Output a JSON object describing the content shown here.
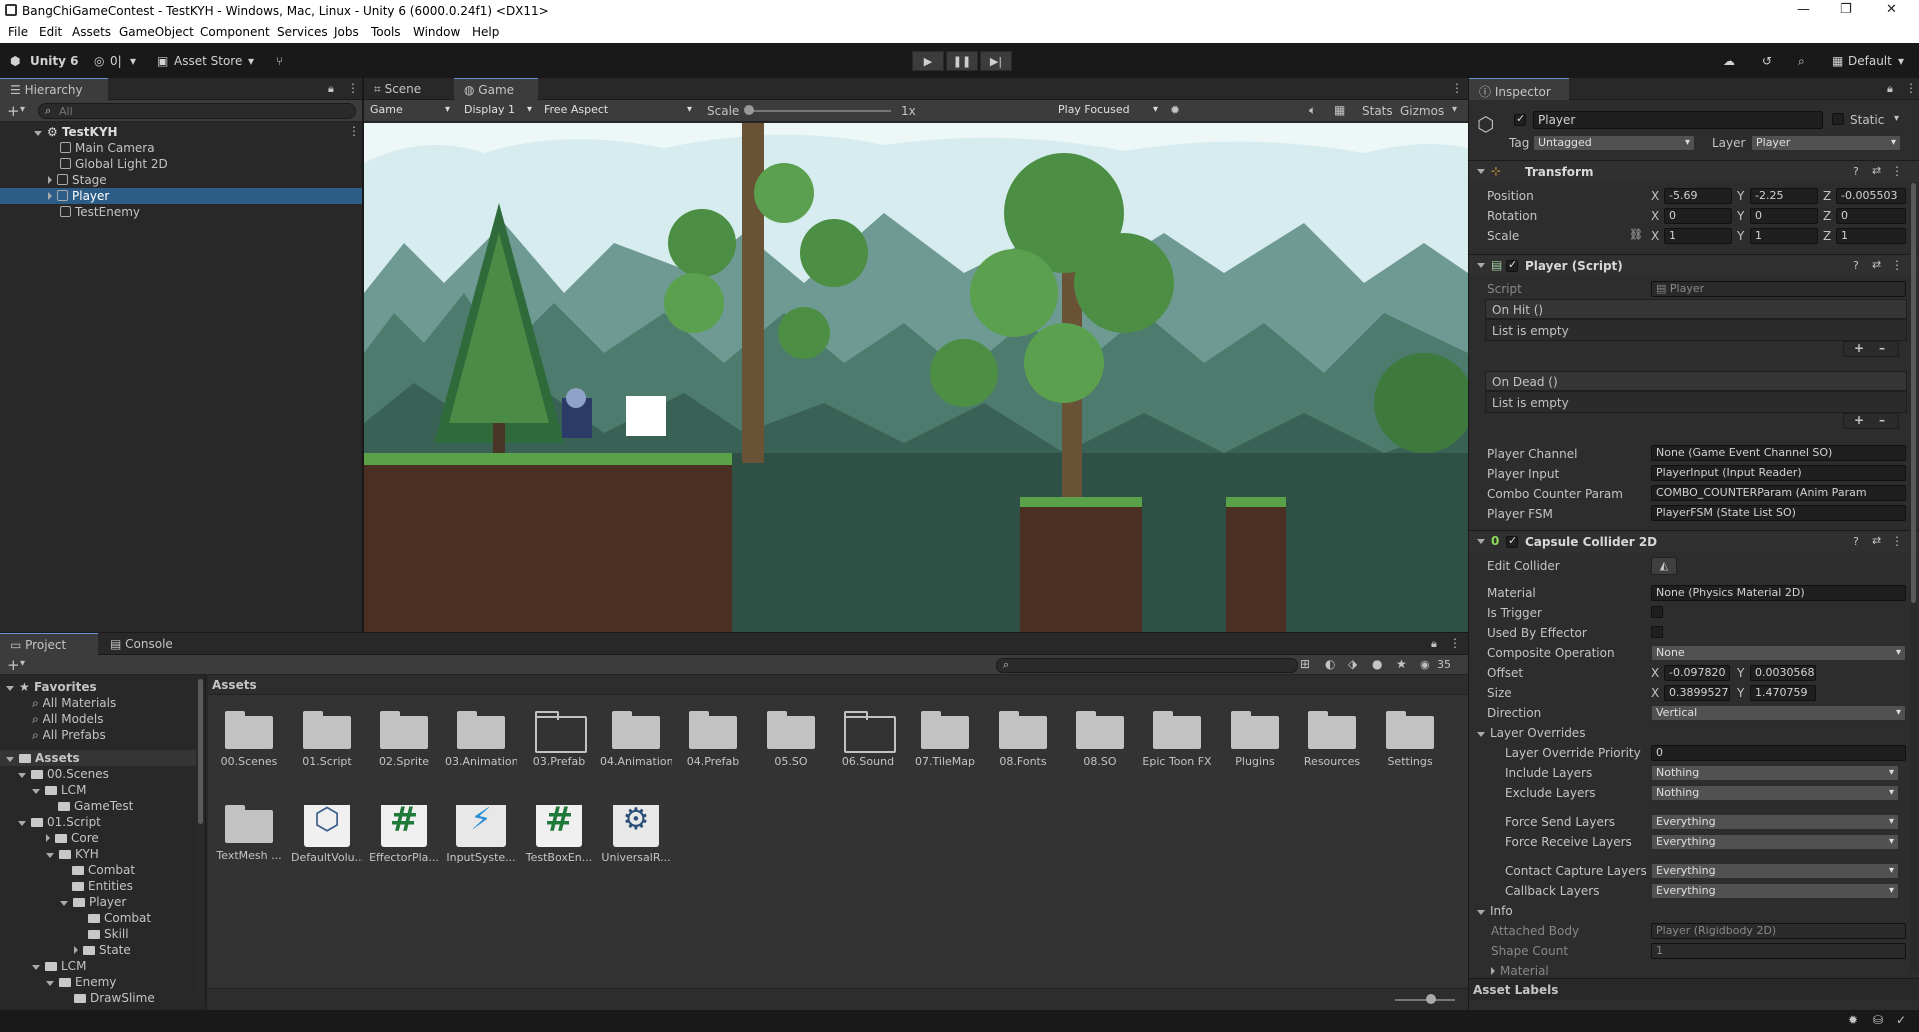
{
  "window": {
    "title": "BangChiGameContest - TestKYH - Windows, Mac, Linux - Unity 6 (6000.0.24f1) <DX11>"
  },
  "menu": [
    "File",
    "Edit",
    "Assets",
    "GameObject",
    "Component",
    "Services",
    "Jobs",
    "Tools",
    "Window",
    "Help"
  ],
  "toolbar": {
    "account": "Unity 6",
    "collab": "0|",
    "asset_store": "Asset Store",
    "layout": "Default"
  },
  "hierarchy": {
    "tab": "Hierarchy",
    "search_placeholder": "All",
    "scene": "TestKYH",
    "items": [
      "Main Camera",
      "Global Light 2D",
      "Stage",
      "Player",
      "TestEnemy"
    ]
  },
  "game_view": {
    "tabs": [
      "Scene",
      "Game"
    ],
    "mode": "Game",
    "display": "Display 1",
    "aspect": "Free Aspect",
    "scale_label": "Scale",
    "scale_value": "1x",
    "play_mode": "Play Focused",
    "stats": "Stats",
    "gizmos": "Gizmos"
  },
  "inspector": {
    "tab": "Inspector",
    "object_name": "Player",
    "static_label": "Static",
    "tag_label": "Tag",
    "tag_value": "Untagged",
    "layer_label": "Layer",
    "layer_value": "Player",
    "transform": {
      "title": "Transform",
      "position_label": "Position",
      "pos_x": "-5.69",
      "pos_y": "-2.25",
      "pos_z": "-0.005503",
      "rotation_label": "Rotation",
      "rot_x": "0",
      "rot_y": "0",
      "rot_z": "0",
      "scale_label": "Scale",
      "scale_x": "1",
      "scale_y": "1",
      "scale_z": "1"
    },
    "player_script": {
      "title": "Player (Script)",
      "script_label": "Script",
      "script_value": "Player",
      "on_hit": "On Hit ()",
      "on_hit_list": "List is empty",
      "on_dead": "On Dead ()",
      "on_dead_list": "List is empty",
      "player_channel_label": "Player Channel",
      "player_channel_value": "None (Game Event Channel SO)",
      "player_input_label": "Player Input",
      "player_input_value": "PlayerInput (Input Reader)",
      "combo_label": "Combo Counter Param",
      "combo_value": "COMBO_COUNTERParam (Anim Param",
      "fsm_label": "Player FSM",
      "fsm_value": "PlayerFSM (State List SO)"
    },
    "collider": {
      "title": "Capsule Collider 2D",
      "edit_label": "Edit Collider",
      "material_label": "Material",
      "material_value": "None (Physics Material 2D)",
      "trigger_label": "Is Trigger",
      "effector_label": "Used By Effector",
      "composite_label": "Composite Operation",
      "composite_value": "None",
      "offset_label": "Offset",
      "offset_x": "-0.097820",
      "offset_y": "0.0030568",
      "size_label": "Size",
      "size_x": "0.3899527",
      "size_y": "1.470759",
      "direction_label": "Direction",
      "direction_value": "Vertical",
      "layer_overrides": "Layer Overrides",
      "priority_label": "Layer Override Priority",
      "priority_value": "0",
      "include_label": "Include Layers",
      "include_value": "Nothing",
      "exclude_label": "Exclude Layers",
      "exclude_value": "Nothing",
      "force_send_label": "Force Send Layers",
      "force_send_value": "Everything",
      "force_receive_label": "Force Receive Layers",
      "force_receive_value": "Everything",
      "contact_label": "Contact Capture Layers",
      "contact_value": "Everything",
      "callback_label": "Callback Layers",
      "callback_value": "Everything",
      "info": "Info",
      "attached_label": "Attached Body",
      "attached_value": "Player (Rigidbody 2D)",
      "shape_label": "Shape Count",
      "shape_value": "1",
      "material_fold": "Material"
    },
    "asset_labels": "Asset Labels"
  },
  "project": {
    "tabs": [
      "Project",
      "Console"
    ],
    "favorites": "Favorites",
    "fav_items": [
      "All Materials",
      "All Models",
      "All Prefabs"
    ],
    "assets_root": "Assets",
    "tree": [
      "00.Scenes",
      "LCM",
      "GameTest",
      "01.Script",
      "Core",
      "KYH",
      "Combat",
      "Entities",
      "Player",
      "Combat",
      "Skill",
      "State",
      "LCM",
      "Enemy",
      "DrawSlime"
    ],
    "breadcrumb": "Assets",
    "count": "35",
    "folders": [
      "00.Scenes",
      "01.Script",
      "02.Sprite",
      "03.Animation",
      "03.Prefab",
      "04.Animation",
      "04.Prefab",
      "05.SO",
      "06.Sound",
      "07.TileMap",
      "08.Fonts",
      "08.SO",
      "Epic Toon FX",
      "Plugins",
      "Resources",
      "Settings",
      "TextMesh ..."
    ],
    "files": [
      "DefaultVolu...",
      "EffectorPla...",
      "InputSyste...",
      "TestBoxEn...",
      "UniversalR..."
    ]
  }
}
